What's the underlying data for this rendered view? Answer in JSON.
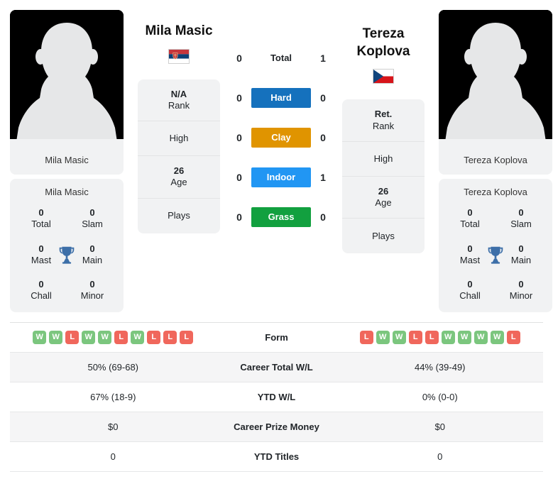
{
  "players": {
    "left": {
      "name": "Mila Masic",
      "name_display": "Mila Masic",
      "avatar_caption": "Mila Masic",
      "flag_country": "Serbia",
      "flag_icon": "serbia-flag-icon",
      "stats": [
        {
          "value": "N/A",
          "label": "Rank"
        },
        {
          "value": "",
          "label": "High"
        },
        {
          "value": "26",
          "label": "Age"
        },
        {
          "value": "",
          "label": "Plays"
        }
      ],
      "titles": {
        "heading": "Mila Masic",
        "trophy_icon": "trophy-icon",
        "cells": [
          {
            "value": "0",
            "label": "Total"
          },
          {
            "value": "0",
            "label": "Slam"
          },
          {
            "value": "0",
            "label": "Mast"
          },
          {
            "value": "0",
            "label": "Main"
          },
          {
            "value": "0",
            "label": "Chall"
          },
          {
            "value": "0",
            "label": "Minor"
          }
        ]
      },
      "form": [
        "W",
        "W",
        "L",
        "W",
        "W",
        "L",
        "W",
        "L",
        "L",
        "L"
      ]
    },
    "right": {
      "name": "Tereza Koplova",
      "name_line1": "Tereza",
      "name_line2": "Koplova",
      "avatar_caption": "Tereza Koplova",
      "flag_country": "Czech Republic",
      "flag_icon": "czech-flag-icon",
      "stats": [
        {
          "value": "Ret.",
          "label": "Rank"
        },
        {
          "value": "",
          "label": "High"
        },
        {
          "value": "26",
          "label": "Age"
        },
        {
          "value": "",
          "label": "Plays"
        }
      ],
      "titles": {
        "heading": "Tereza Koplova",
        "trophy_icon": "trophy-icon",
        "cells": [
          {
            "value": "0",
            "label": "Total"
          },
          {
            "value": "0",
            "label": "Slam"
          },
          {
            "value": "0",
            "label": "Mast"
          },
          {
            "value": "0",
            "label": "Main"
          },
          {
            "value": "0",
            "label": "Chall"
          },
          {
            "value": "0",
            "label": "Minor"
          }
        ]
      },
      "form": [
        "L",
        "W",
        "W",
        "L",
        "L",
        "W",
        "W",
        "W",
        "W",
        "L"
      ]
    }
  },
  "h2h": {
    "rows": [
      {
        "label": "Total",
        "left": "0",
        "right": "1",
        "color": "none",
        "styled": false
      },
      {
        "label": "Hard",
        "left": "0",
        "right": "0",
        "color": "#1571bd",
        "styled": true
      },
      {
        "label": "Clay",
        "left": "0",
        "right": "0",
        "color": "#e09400",
        "styled": true
      },
      {
        "label": "Indoor",
        "left": "0",
        "right": "1",
        "color": "#2196f3",
        "styled": true
      },
      {
        "label": "Grass",
        "left": "0",
        "right": "0",
        "color": "#12a03f",
        "styled": true
      }
    ]
  },
  "stats_table": {
    "rows": [
      {
        "id": "form",
        "left": "",
        "label": "Form",
        "right": "",
        "type": "form"
      },
      {
        "id": "career-total-wl",
        "left": "50% (69-68)",
        "label": "Career Total W/L",
        "right": "44% (39-49)",
        "type": "text"
      },
      {
        "id": "ytd-wl",
        "left": "67% (18-9)",
        "label": "YTD W/L",
        "right": "0% (0-0)",
        "type": "text"
      },
      {
        "id": "career-prize-money",
        "left": "$0",
        "label": "Career Prize Money",
        "right": "$0",
        "type": "text"
      },
      {
        "id": "ytd-titles",
        "left": "0",
        "label": "YTD Titles",
        "right": "0",
        "type": "text"
      }
    ]
  },
  "colors": {
    "hard": "#1571bd",
    "clay": "#e09400",
    "indoor": "#2196f3",
    "grass": "#12a03f",
    "win": "#7bc67e",
    "loss": "#f0675c",
    "trophy": "#3d6fa8",
    "card_bg": "#f1f2f3"
  }
}
